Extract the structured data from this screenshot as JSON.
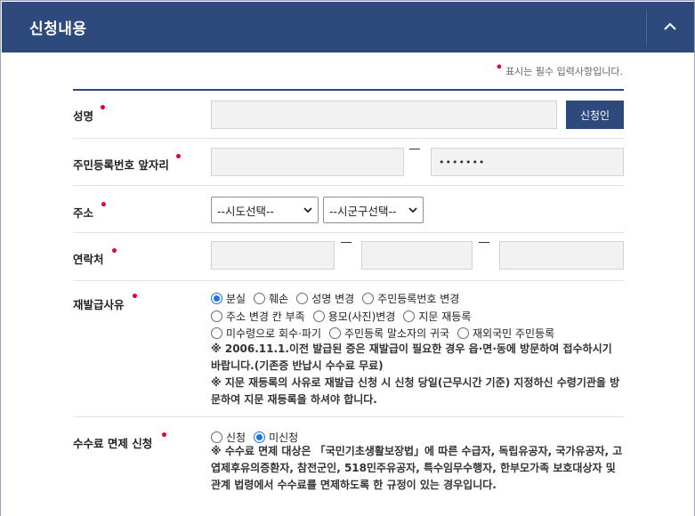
{
  "header": {
    "title": "신청내용",
    "collapse_icon": "chevron-up-icon"
  },
  "required_note": "표시는 필수 입력사항입니다.",
  "name": {
    "label": "성명",
    "value": "",
    "button": "신청인"
  },
  "rrn": {
    "label": "주민등록번호 앞자리",
    "front": "",
    "back_masked": "•••••••"
  },
  "address": {
    "label": "주소",
    "sido_selected": "--시도선택--",
    "sigungu_selected": "--시군구선택--"
  },
  "contact": {
    "label": "연락처",
    "part1": "",
    "part2": "",
    "part3": ""
  },
  "reason": {
    "label": "재발급사유",
    "options_row1": [
      "분실",
      "훼손",
      "성명 변경",
      "주민등록번호 변경"
    ],
    "options_row2": [
      "주소 변경 칸 부족",
      "용모(사진)변경",
      "지문 재등록"
    ],
    "options_row3": [
      "미수령으로 회수·파기",
      "주민등록 말소자의 귀국",
      "재외국민 주민등록"
    ],
    "selected": "분실",
    "note1": "※ 2006.11.1.이전 발급된 증은 재발급이 필요한 경우 읍·면·동에 방문하여 접수하시기 바랍니다.(기존증 반납시 수수료 무료)",
    "note2": "※ 지문 재등록의 사유로 재발급 신청 시 신청 당일(근무시간 기준) 지정하신 수령기관을 방문하여 지문 재등록을 하셔야 합니다."
  },
  "fee": {
    "label": "수수료 면제 신청",
    "options": [
      "신청",
      "미신청"
    ],
    "selected": "미신청",
    "note": "※ 수수료 면제 대상은 「국민기초생활보장법」에 따른 수급자, 독립유공자, 국가유공자, 고엽제후유의증환자, 참전군인, 518민주유공자, 특수임무수행자, 한부모가족 보호대상자 및 관계 법령에서 수수료를 면제하도록 한 규정이 있는 경우입니다."
  },
  "colors": {
    "header_bg": "#2e4a7c",
    "required_dot": "#e4002b",
    "radio_checked": "#1a73e8"
  }
}
